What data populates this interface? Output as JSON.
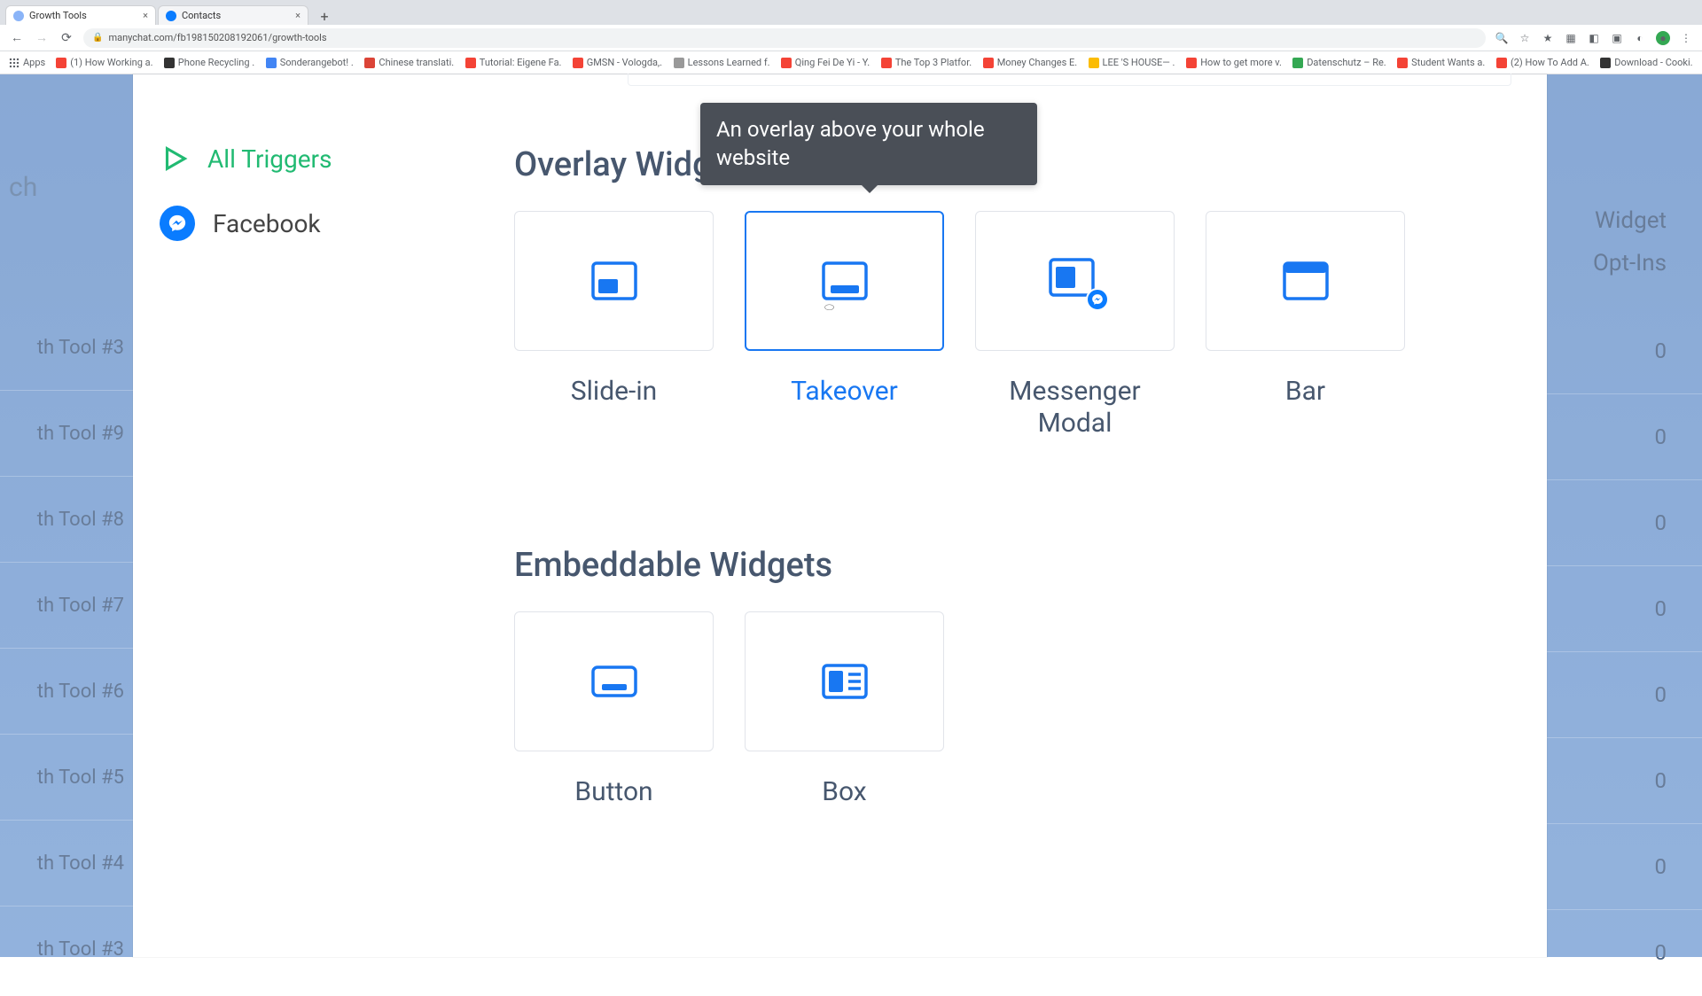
{
  "browser": {
    "tabs": [
      {
        "title": "Growth Tools",
        "active": true
      },
      {
        "title": "Contacts",
        "active": false
      }
    ],
    "url": "manychat.com/fb198150208192061/growth-tools",
    "bookmarks": [
      "(1) How Working a...",
      "Phone Recycling ...",
      "Sonderangebot! ...",
      "Chinese translati...",
      "Tutorial: Eigene Fa...",
      "GMSN - Vologda,...",
      "Lessons Learned f...",
      "Qing Fei De Yi - Y...",
      "The Top 3 Platfor...",
      "Money Changes E...",
      "LEE 'S HOUSE— ...",
      "How to get more v...",
      "Datenschutz – Re...",
      "Student Wants a...",
      "(2) How To Add A...",
      "Download - Cooki..."
    ],
    "appsLabel": "Apps"
  },
  "sidebar": {
    "allTriggers": "All Triggers",
    "facebook": "Facebook"
  },
  "sections": {
    "overlay": "Overlay Widgets",
    "embeddable": "Embeddable Widgets"
  },
  "overlayWidgets": [
    {
      "label": "Slide-in"
    },
    {
      "label": "Takeover"
    },
    {
      "label": "Messenger Modal"
    },
    {
      "label": "Bar"
    }
  ],
  "embeddableWidgets": [
    {
      "label": "Button"
    },
    {
      "label": "Box"
    }
  ],
  "tooltip": "An overlay above your whole website",
  "background": {
    "leftSearch": "ch",
    "leftRows": [
      "th Tool #3",
      "th Tool #9",
      "th Tool #8",
      "th Tool #7",
      "th Tool #6",
      "th Tool #5",
      "th Tool #4",
      "th Tool #3"
    ],
    "rightHead1": "Widget",
    "rightHead2": "Opt-Ins",
    "rightValues": [
      0,
      0,
      0,
      0,
      0,
      0,
      0,
      0
    ]
  }
}
